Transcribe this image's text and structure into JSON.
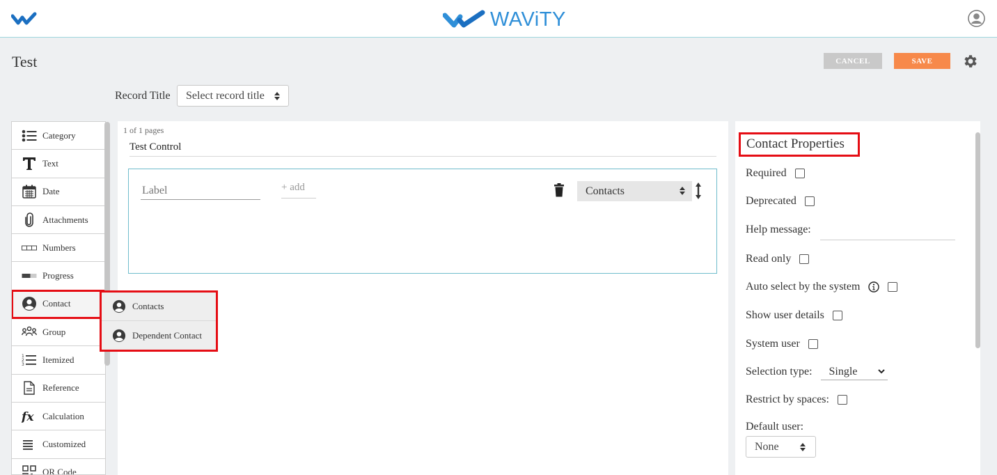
{
  "header": {
    "brand": "WAViTY",
    "colors": {
      "brand_blue": "#2f8fd8",
      "brand_dark": "#1b6fc1"
    }
  },
  "page": {
    "title": "Test",
    "cancel_label": "CANCEL",
    "save_label": "SAVE",
    "record_title_label": "Record Title",
    "record_title_select": "Select record title"
  },
  "palette": {
    "items": [
      {
        "label": "Category",
        "icon": "list-bullets-icon"
      },
      {
        "label": "Text",
        "icon": "text-t-icon"
      },
      {
        "label": "Date",
        "icon": "calendar-icon"
      },
      {
        "label": "Attachments",
        "icon": "paperclip-icon"
      },
      {
        "label": "Numbers",
        "icon": "numbers-boxes-icon"
      },
      {
        "label": "Progress",
        "icon": "progress-bar-icon"
      },
      {
        "label": "Contact",
        "icon": "person-circle-icon"
      },
      {
        "label": "Group",
        "icon": "group-people-icon"
      },
      {
        "label": "Itemized",
        "icon": "numbered-list-icon"
      },
      {
        "label": "Reference",
        "icon": "document-icon"
      },
      {
        "label": "Calculation",
        "icon": "function-fx-icon"
      },
      {
        "label": "Customized",
        "icon": "lines-icon"
      },
      {
        "label": "QR Code",
        "icon": "qr-code-icon"
      }
    ]
  },
  "submenu": {
    "items": [
      {
        "label": "Contacts"
      },
      {
        "label": "Dependent Contact"
      }
    ]
  },
  "canvas": {
    "page_count": "1 of 1 pages",
    "page_name": "Test Control",
    "label_placeholder": "Label",
    "add_text": "+ add",
    "type_value": "Contacts"
  },
  "properties": {
    "title": "Contact Properties",
    "required": "Required",
    "deprecated": "Deprecated",
    "help_message": "Help message:",
    "read_only": "Read only",
    "auto_select": "Auto select by the system",
    "show_user_details": "Show user details",
    "system_user": "System user",
    "selection_type_label": "Selection type:",
    "selection_type_value": "Single",
    "restrict_by_spaces": "Restrict by spaces:",
    "default_user_label": "Default user:",
    "default_user_value": "None"
  }
}
